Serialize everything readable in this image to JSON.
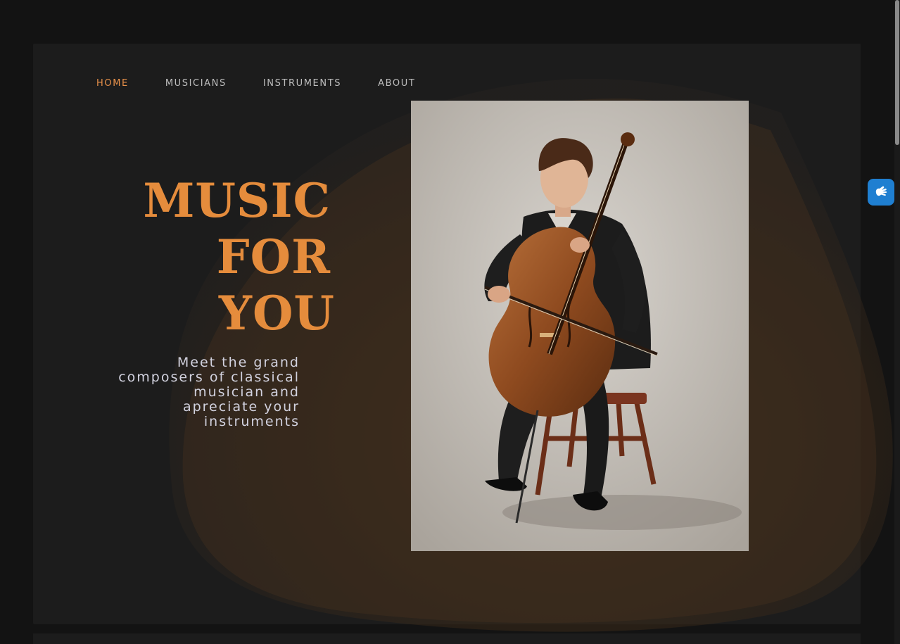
{
  "nav": {
    "items": [
      {
        "label": "HOME",
        "active": true
      },
      {
        "label": "MUSICIANS",
        "active": false
      },
      {
        "label": "INSTRUMENTS",
        "active": false
      },
      {
        "label": "ABOUT",
        "active": false
      }
    ]
  },
  "hero": {
    "title_lines": [
      "MUSIC",
      "FOR",
      "YOU"
    ],
    "subtitle": "Meet the grand composers of classical musician and apreciate your instruments",
    "image_icon": "cellist-illustration"
  },
  "accessibility": {
    "icon": "sign-language-icon"
  },
  "colors": {
    "background": "#131313",
    "panel": "#1c1c1c",
    "accent": "#e58c3c",
    "nav_text": "#bdbdbd",
    "subtitle_text": "#d2d2df",
    "a11y_button": "#1f7fd1"
  }
}
